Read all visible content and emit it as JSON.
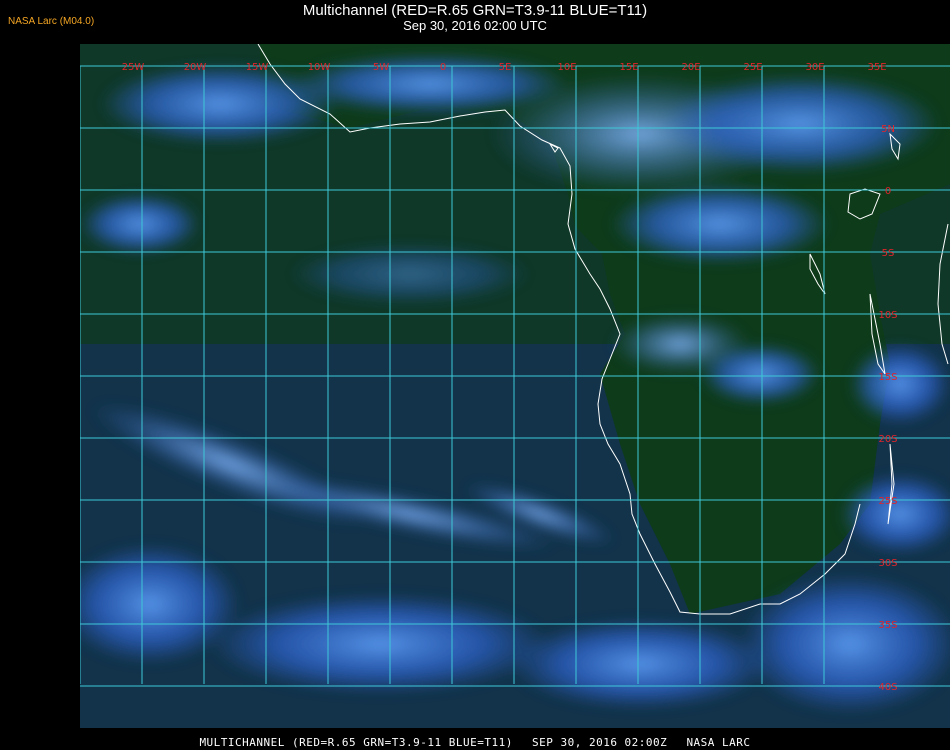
{
  "credit": "NASA Larc (M04.0)",
  "title": "Multichannel (RED=R.65 GRN=T3.9-11 BLUE=T11)",
  "subtitle": "Sep 30, 2016 02:00 UTC",
  "longitude_labels": [
    "25W",
    "20W",
    "15W",
    "10W",
    "5W",
    "0",
    "5E",
    "10E",
    "15E",
    "20E",
    "25E",
    "30E",
    "35E"
  ],
  "latitude_labels": [
    "5N",
    "0",
    "5S",
    "10S",
    "15S",
    "20S",
    "25S",
    "30S",
    "35S",
    "40S"
  ],
  "footer": {
    "product": "MULTICHANNEL (RED=R.65 GRN=T3.9-11 BLUE=T11)",
    "datetime": "SEP 30, 2016 02:00Z",
    "source": "NASA LARC"
  },
  "colors": {
    "grid": "#3ec8d8",
    "grid_labels": "#e0252b",
    "coastline": "#ffffff",
    "ocean": "#123a52",
    "land": "#0e3a1c",
    "cloud": "#3f7de0",
    "credit": "#f5a623"
  }
}
